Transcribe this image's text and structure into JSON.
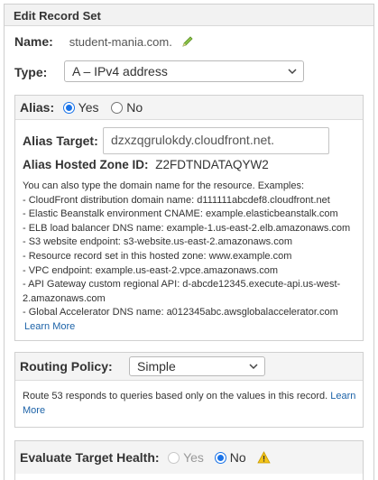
{
  "panel": {
    "title": "Edit Record Set"
  },
  "name": {
    "label": "Name:",
    "value": "student-mania.com."
  },
  "type": {
    "label": "Type:",
    "value": "A – IPv4 address"
  },
  "alias": {
    "label": "Alias:",
    "yes_label": "Yes",
    "no_label": "No",
    "selected": "Yes",
    "target_label": "Alias Target:",
    "target_value": "dzxzqgrulokdy.cloudfront.net.",
    "zone_label": "Alias Hosted Zone ID:",
    "zone_value": "Z2FDTNDATAQYW2",
    "help_intro": "You can also type the domain name for the resource. Examples:",
    "examples": [
      "- CloudFront distribution domain name: d111111abcdef8.cloudfront.net",
      "- Elastic Beanstalk environment CNAME: example.elasticbeanstalk.com",
      "- ELB load balancer DNS name: example-1.us-east-2.elb.amazonaws.com",
      "- S3 website endpoint: s3-website.us-east-2.amazonaws.com",
      "- Resource record set in this hosted zone: www.example.com",
      "- VPC endpoint: example.us-east-2.vpce.amazonaws.com",
      "- API Gateway custom regional API: d-abcde12345.execute-api.us-west-",
      "2.amazonaws.com",
      "- Global Accelerator DNS name: a012345abc.awsglobalaccelerator.com"
    ],
    "learn_more": "Learn More"
  },
  "routing": {
    "label": "Routing Policy:",
    "value": "Simple",
    "help": "Route 53 responds to queries based only on the values in this record.",
    "learn_more_a": "Learn",
    "learn_more_b": "More"
  },
  "health": {
    "label": "Evaluate Target Health:",
    "yes_label": "Yes",
    "no_label": "No",
    "selected": "No"
  },
  "icons": {
    "pencil": "pencil-icon",
    "caret": "chevron-down-icon",
    "warning": "warning-icon"
  },
  "colors": {
    "link": "#1d63a8",
    "radio": "#1a73e8",
    "warning": "#f5c518"
  }
}
